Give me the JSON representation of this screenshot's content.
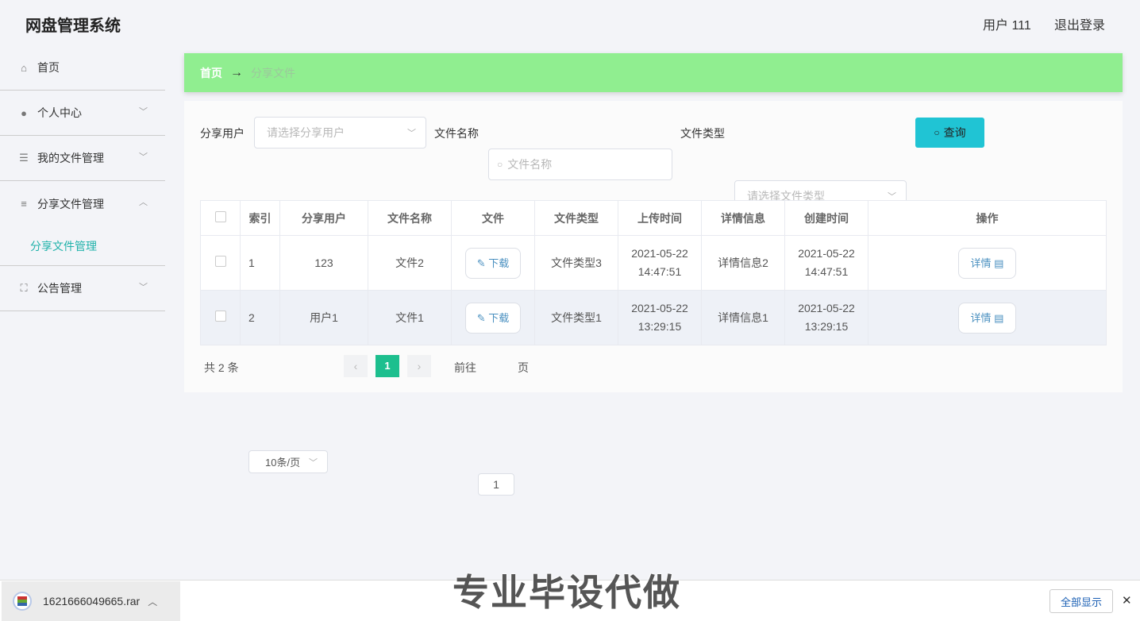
{
  "header": {
    "title": "网盘管理系统",
    "user": "用户 111",
    "logout": "退出登录"
  },
  "sidebar": {
    "items": [
      {
        "label": "首页",
        "icon": "home-icon"
      },
      {
        "label": "个人中心",
        "icon": "user-icon"
      },
      {
        "label": "我的文件管理",
        "icon": "sliders-icon"
      },
      {
        "label": "分享文件管理",
        "icon": "list-icon"
      },
      {
        "label": "公告管理",
        "icon": "frame-icon"
      }
    ],
    "sub": "分享文件管理"
  },
  "breadcrumb": {
    "home": "首页",
    "arrow": "→",
    "current": "分享文件"
  },
  "search": {
    "user_label": "分享用户",
    "user_placeholder": "请选择分享用户",
    "name_label": "文件名称",
    "name_placeholder": "文件名称",
    "type_label": "文件类型",
    "type_placeholder": "请选择文件类型",
    "query": "查询"
  },
  "table": {
    "headers": [
      "索引",
      "分享用户",
      "文件名称",
      "文件",
      "文件类型",
      "上传时间",
      "详情信息",
      "创建时间",
      "操作"
    ],
    "rows": [
      {
        "idx": "1",
        "user": "123",
        "name": "文件2",
        "download": "下载",
        "type": "文件类型3",
        "upload_date": "2021-05-22",
        "upload_time": "14:47:51",
        "info": "详情信息2",
        "create_date": "2021-05-22",
        "create_time": "14:47:51",
        "detail": "详情"
      },
      {
        "idx": "2",
        "user": "用户1",
        "name": "文件1",
        "download": "下载",
        "type": "文件类型1",
        "upload_date": "2021-05-22",
        "upload_time": "13:29:15",
        "info": "详情信息1",
        "create_date": "2021-05-22",
        "create_time": "13:29:15",
        "detail": "详情"
      }
    ]
  },
  "pagination": {
    "total": "共 2 条",
    "page_size": "10条/页",
    "current": "1",
    "goto_label": "前往",
    "goto_value": "1",
    "page_suffix": "页"
  },
  "download_bar": {
    "file": "1621666049665.rar",
    "show_all": "全部显示",
    "close": "✕"
  },
  "watermark": "专业毕设代做"
}
